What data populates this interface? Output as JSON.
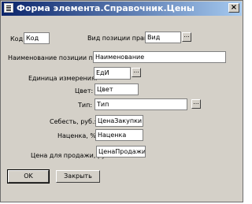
{
  "window": {
    "title": "Форма элемента.Справочник.Цены",
    "close_symbol": "×"
  },
  "fields": {
    "code": {
      "label": "Код:",
      "value": "Код"
    },
    "price_item_kind": {
      "label": "Вид позиции прайса:",
      "value": "Вид"
    },
    "price_item_name": {
      "label": "Наименование позиции прайса:",
      "value": "Наименование"
    },
    "unit": {
      "label": "Единица измерения:",
      "value": "ЕдИ"
    },
    "color": {
      "label": "Цвет:",
      "value": "Цвет"
    },
    "type": {
      "label": "Тип:",
      "value": "Тип"
    },
    "cost": {
      "label": "Себесть, руб.:",
      "value": "ЦенаЗакупки"
    },
    "markup": {
      "label": "Наценка, %:",
      "value": "Наценка"
    },
    "sale_price": {
      "label": "Цена для продажи, руб.:",
      "value": "ЦенаПродажи"
    }
  },
  "select_button_label": "...",
  "buttons": {
    "ok": "OK",
    "close": "Закрыть"
  }
}
